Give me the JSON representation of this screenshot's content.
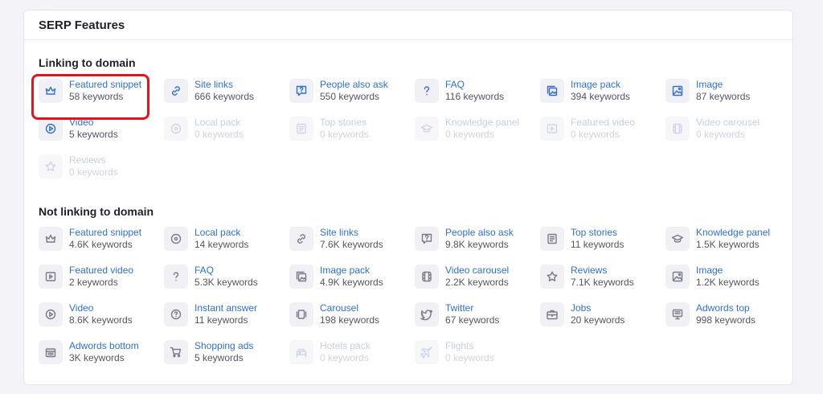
{
  "title": "SERP Features",
  "colors": {
    "link": "#2f6fd6",
    "highlight": "#e0161e",
    "muted": "#c5cfe0"
  },
  "sections": [
    {
      "title": "Linking to domain",
      "items": [
        {
          "label": "Featured snippet",
          "count": "58 keywords",
          "icon": "crown-icon",
          "state": "active"
        },
        {
          "label": "Site links",
          "count": "666 keywords",
          "icon": "link-icon",
          "state": "active"
        },
        {
          "label": "People also ask",
          "count": "550 keywords",
          "icon": "question-bubble-icon",
          "state": "active"
        },
        {
          "label": "FAQ",
          "count": "116 keywords",
          "icon": "question-icon",
          "state": "active"
        },
        {
          "label": "Image pack",
          "count": "394 keywords",
          "icon": "image-pack-icon",
          "state": "active"
        },
        {
          "label": "Image",
          "count": "87 keywords",
          "icon": "image-icon",
          "state": "active"
        },
        {
          "label": "Video",
          "count": "5 keywords",
          "icon": "video-play-icon",
          "state": "active"
        },
        {
          "label": "Local pack",
          "count": "0 keywords",
          "icon": "map-pin-icon",
          "state": "disabled"
        },
        {
          "label": "Top stories",
          "count": "0 keywords",
          "icon": "newspaper-icon",
          "state": "disabled"
        },
        {
          "label": "Knowledge panel",
          "count": "0 keywords",
          "icon": "graduation-cap-icon",
          "state": "disabled"
        },
        {
          "label": "Featured video",
          "count": "0 keywords",
          "icon": "featured-video-icon",
          "state": "disabled"
        },
        {
          "label": "Video carousel",
          "count": "0 keywords",
          "icon": "film-icon",
          "state": "disabled"
        },
        {
          "label": "Reviews",
          "count": "0 keywords",
          "icon": "star-icon",
          "state": "disabled"
        }
      ]
    },
    {
      "title": "Not linking to domain",
      "items": [
        {
          "label": "Featured snippet",
          "count": "4.6K keywords",
          "icon": "crown-icon",
          "state": "inactive"
        },
        {
          "label": "Local pack",
          "count": "14 keywords",
          "icon": "map-pin-icon",
          "state": "inactive"
        },
        {
          "label": "Site links",
          "count": "7.6K keywords",
          "icon": "link-icon",
          "state": "inactive"
        },
        {
          "label": "People also ask",
          "count": "9.8K keywords",
          "icon": "question-bubble-icon",
          "state": "inactive"
        },
        {
          "label": "Top stories",
          "count": "11 keywords",
          "icon": "newspaper-icon",
          "state": "inactive"
        },
        {
          "label": "Knowledge panel",
          "count": "1.5K keywords",
          "icon": "graduation-cap-icon",
          "state": "inactive"
        },
        {
          "label": "Featured video",
          "count": "2 keywords",
          "icon": "featured-video-icon",
          "state": "inactive"
        },
        {
          "label": "FAQ",
          "count": "5.3K keywords",
          "icon": "question-icon",
          "state": "inactive"
        },
        {
          "label": "Image pack",
          "count": "4.9K keywords",
          "icon": "image-pack-icon",
          "state": "inactive"
        },
        {
          "label": "Video carousel",
          "count": "2.2K keywords",
          "icon": "film-icon",
          "state": "inactive"
        },
        {
          "label": "Reviews",
          "count": "7.1K keywords",
          "icon": "star-icon",
          "state": "inactive"
        },
        {
          "label": "Image",
          "count": "1.2K keywords",
          "icon": "image-icon",
          "state": "inactive"
        },
        {
          "label": "Video",
          "count": "8.6K keywords",
          "icon": "video-play-icon",
          "state": "inactive"
        },
        {
          "label": "Instant answer",
          "count": "11 keywords",
          "icon": "instant-answer-icon",
          "state": "inactive"
        },
        {
          "label": "Carousel",
          "count": "198 keywords",
          "icon": "carousel-icon",
          "state": "inactive"
        },
        {
          "label": "Twitter",
          "count": "67 keywords",
          "icon": "twitter-icon",
          "state": "inactive"
        },
        {
          "label": "Jobs",
          "count": "20 keywords",
          "icon": "briefcase-icon",
          "state": "inactive"
        },
        {
          "label": "Adwords top",
          "count": "998 keywords",
          "icon": "ad-top-icon",
          "state": "inactive"
        },
        {
          "label": "Adwords bottom",
          "count": "3K keywords",
          "icon": "ad-bottom-icon",
          "state": "inactive"
        },
        {
          "label": "Shopping ads",
          "count": "5 keywords",
          "icon": "cart-icon",
          "state": "inactive"
        },
        {
          "label": "Hotels pack",
          "count": "0 keywords",
          "icon": "hotel-icon",
          "state": "disabled"
        },
        {
          "label": "Flights",
          "count": "0 keywords",
          "icon": "plane-icon",
          "state": "disabled"
        }
      ]
    }
  ]
}
